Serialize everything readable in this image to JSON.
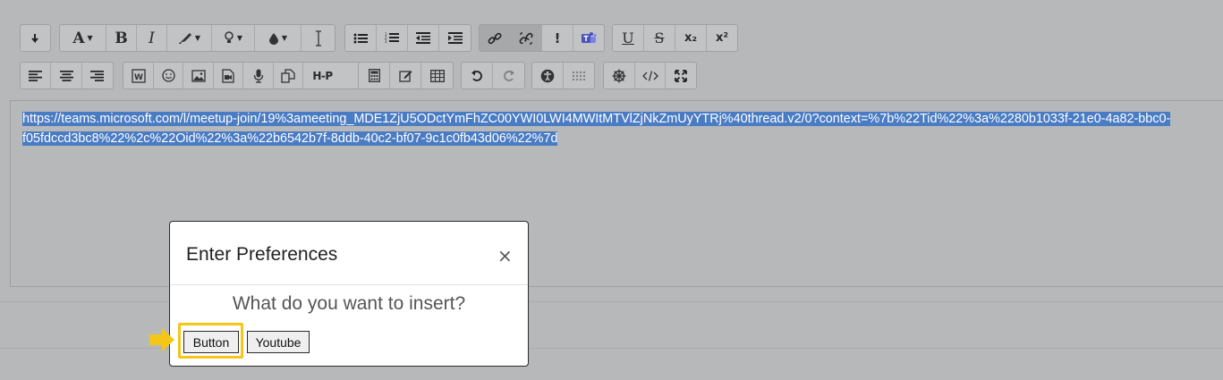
{
  "editor": {
    "selected_text": "https://teams.microsoft.com/l/meetup-join/19%3ameeting_MDE1ZjU5ODctYmFhZC00YWI0LWI4MWItMTVlZjNkZmUyYTRj%40thread.v2/0?context=%7b%22Tid%22%3a%2280b1033f-21e0-4a82-bbc0-f05fdccd3bc8%22%2c%22Oid%22%3a%22b6542b7f-8ddb-40c2-bf07-9c1c0fb43d06%22%7d"
  },
  "toolbar": {
    "bold": "B",
    "italic": "I",
    "font_color": "A",
    "important": "!",
    "underline": "U",
    "strike": "S",
    "subscript": "x₂",
    "superscript": "x²",
    "h5p": "H-P",
    "row1_icons": [
      "collapse-icon",
      "font-color-icon",
      "bold-icon",
      "italic-icon",
      "highlight-icon",
      "bulb-icon",
      "drop-icon",
      "cursor-icon",
      "unordered-list-icon",
      "ordered-list-icon",
      "outdent-icon",
      "indent-icon",
      "link-icon",
      "unlink-icon",
      "important-icon",
      "teams-icon",
      "underline-icon",
      "strikethrough-icon",
      "subscript-icon",
      "superscript-icon"
    ],
    "row2_icons": [
      "align-left-icon",
      "align-center-icon",
      "align-right-icon",
      "word-paste-icon",
      "emoji-icon",
      "image-icon",
      "media-icon",
      "microphone-icon",
      "manage-files-icon",
      "h5p-icon",
      "calculator-icon",
      "edit-icon",
      "table-icon",
      "undo-icon",
      "redo-icon",
      "accessibility-icon",
      "screen-reader-icon",
      "settings-icon",
      "html-icon",
      "fullscreen-icon"
    ]
  },
  "modal": {
    "title": "Enter Preferences",
    "close_symbol": "×",
    "question": "What do you want to insert?",
    "buttons": [
      "Button",
      "Youtube"
    ]
  },
  "colors": {
    "overlay": "#b6b8ba",
    "selection": "#4a7cc4",
    "highlight": "#f5c518"
  }
}
